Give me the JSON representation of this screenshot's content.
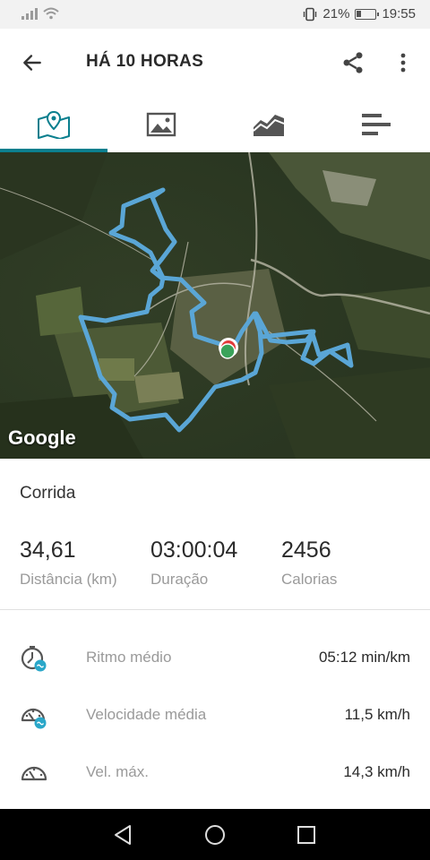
{
  "status_bar": {
    "battery": "21%",
    "time": "19:55"
  },
  "app_bar": {
    "title": "HÁ 10 HORAS"
  },
  "tabs": [
    {
      "icon": "map-icon",
      "active": true
    },
    {
      "icon": "image-icon",
      "active": false
    },
    {
      "icon": "chart-icon",
      "active": false
    },
    {
      "icon": "list-icon",
      "active": false
    }
  ],
  "map": {
    "attribution": "Google",
    "route_color": "#5aa6d6",
    "marker_color": "#3aa35a"
  },
  "summary": {
    "activity_type": "Corrida",
    "stats": [
      {
        "value": "34,61",
        "label": "Distância (km)"
      },
      {
        "value": "03:00:04",
        "label": "Duração"
      },
      {
        "value": "2456",
        "label": "Calorias"
      }
    ]
  },
  "metrics": [
    {
      "icon": "stopwatch-icon",
      "label": "Ritmo médio",
      "value": "05:12 min/km"
    },
    {
      "icon": "speedometer-icon",
      "label": "Velocidade média",
      "value": "11,5 km/h"
    },
    {
      "icon": "speedometer-icon",
      "label": "Vel. máx.",
      "value": "14,3 km/h"
    }
  ],
  "colors": {
    "accent": "#0a7f8e",
    "icon_badge": "#2aa7c9"
  }
}
